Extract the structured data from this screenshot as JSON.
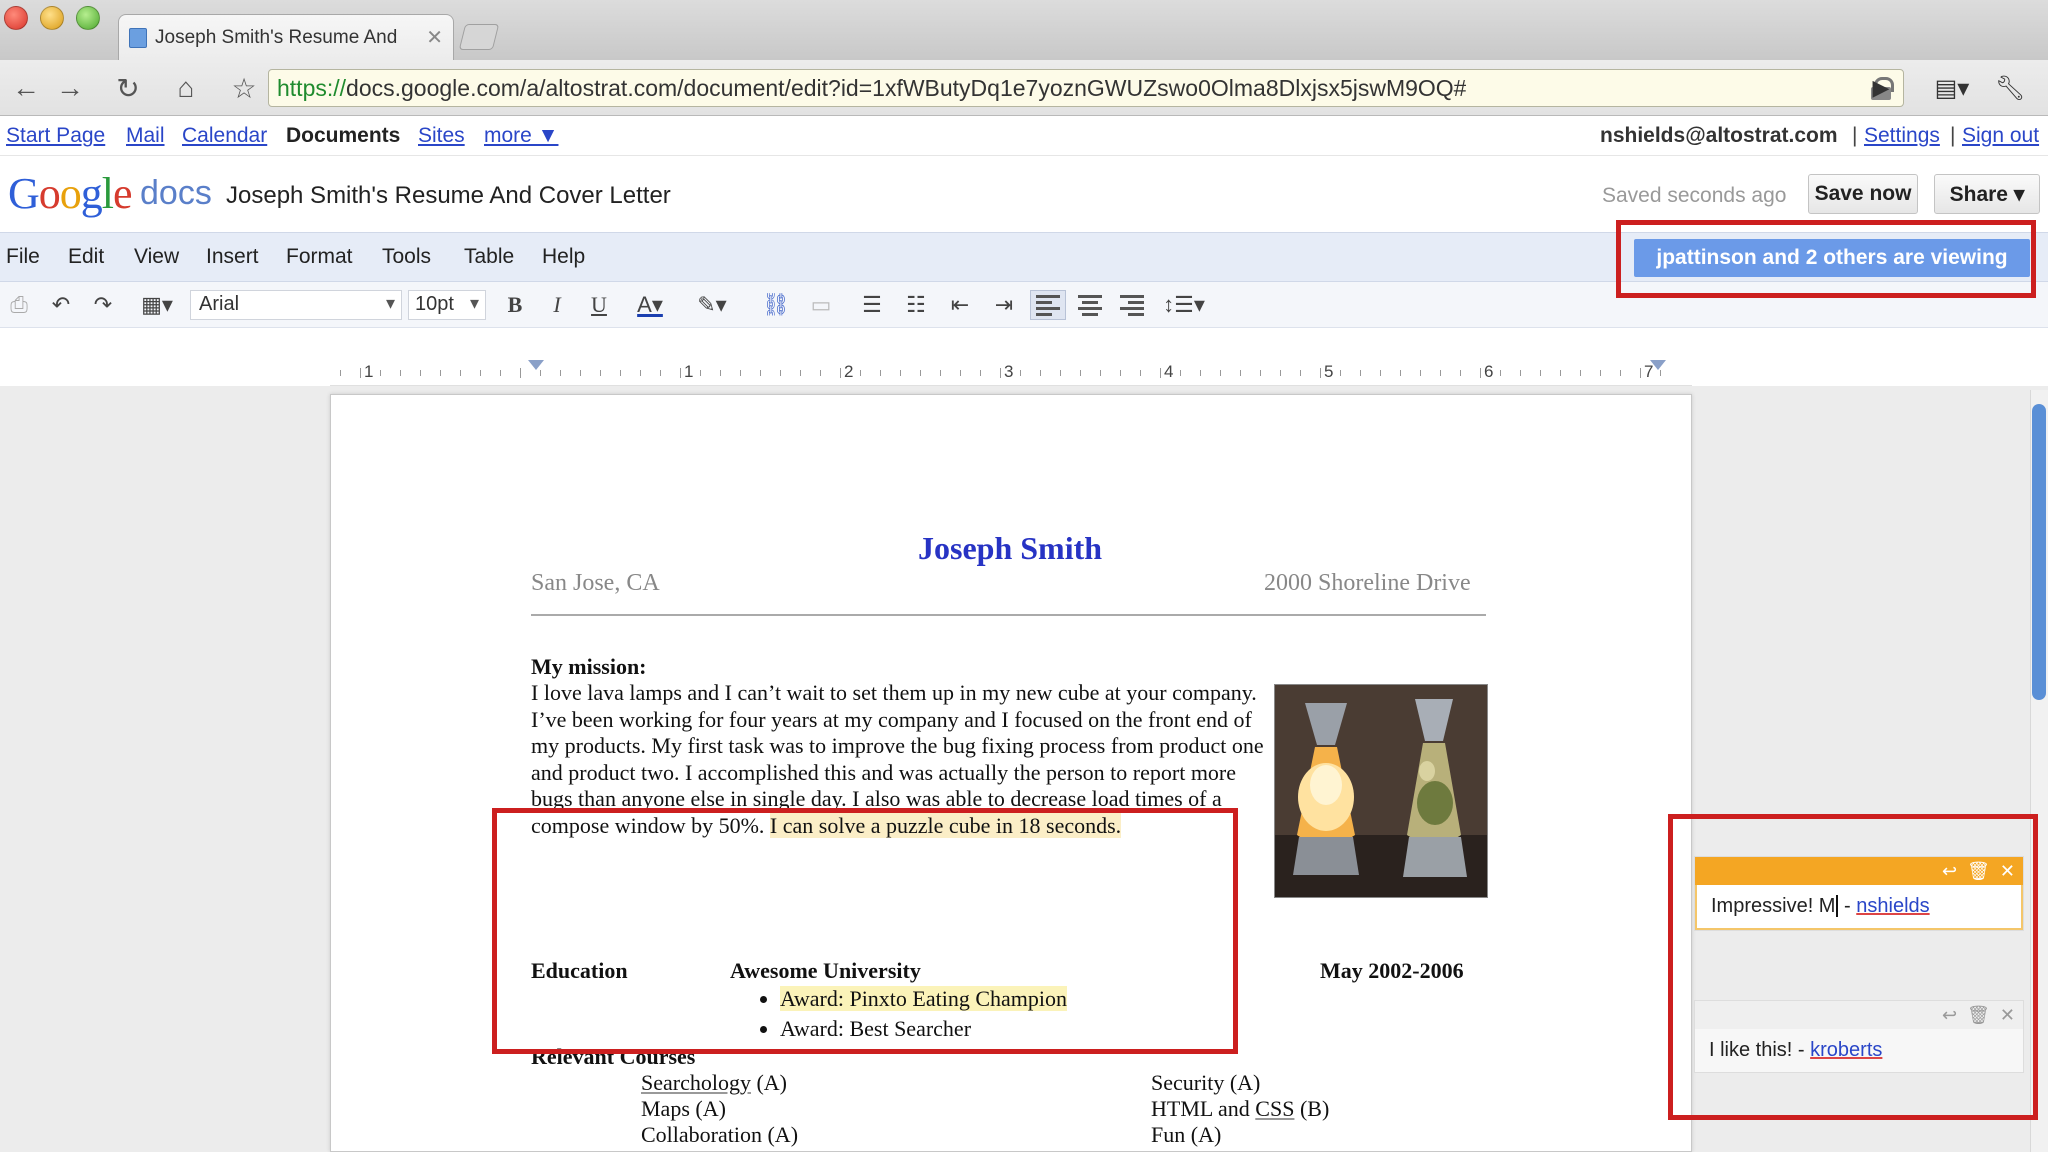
{
  "browser": {
    "tab_title": "Joseph Smith's Resume And",
    "url_scheme": "https://",
    "url_rest": "docs.google.com/a/altostrat.com/document/edit?id=1xfWButyDq1e7yoznGWUZswo0Olma8Dlxjsx5jswM9OQ#"
  },
  "gbar": {
    "links": [
      "Start Page",
      "Mail",
      "Calendar",
      "Documents",
      "Sites",
      "more ▼"
    ],
    "user": "nshields@altostrat.com",
    "settings": "Settings",
    "signout": "Sign out"
  },
  "docs": {
    "docs_word": "docs",
    "title": "Joseph Smith's Resume And Cover Letter",
    "saved_status": "Saved seconds ago",
    "save_now": "Save now",
    "share": "Share ▾",
    "viewing": "jpattinson and 2 others are viewing"
  },
  "menu": [
    "File",
    "Edit",
    "View",
    "Insert",
    "Format",
    "Tools",
    "Table",
    "Help"
  ],
  "toolbar": {
    "font": "Arial",
    "size": "10pt"
  },
  "ruler": [
    "1",
    "1",
    "2",
    "3",
    "4",
    "5",
    "6",
    "7"
  ],
  "doc": {
    "name": "Joseph Smith",
    "location": "San Jose, CA",
    "address": "2000 Shoreline Drive",
    "mission_heading": "My mission:",
    "mission_text": "I love lava lamps and I can’t wait to set them up in my new cube at your company.  I’ve been working for four years at my company and I focused on the front end of my products.  My first task was to improve the bug fixing process from product one and product two.  I accomplished this and was actually the person to report more bugs than anyone else in single day.  I also was able to decrease load times of a compose window by 50%. ",
    "mission_highlight": "I can solve a puzzle cube in 18 seconds.",
    "education_heading": "Education",
    "university": "Awesome University",
    "dates": "May 2002-2006",
    "awards": [
      "Award: Pinxto Eating Champion",
      "Award: Best Searcher"
    ],
    "courses_heading": "Relevant Courses",
    "courses_left": [
      {
        "name": "Searchology",
        "grade": " (A)"
      },
      {
        "name": "Maps",
        "grade": " (A)"
      },
      {
        "name": "Collaboration",
        "grade": " (A)"
      }
    ],
    "courses_right": [
      {
        "name": "Security",
        "grade": " (A)"
      },
      {
        "pre": "HTML and ",
        "name": "CSS",
        "grade": " (B)"
      },
      {
        "name": "Fun",
        "grade": " (A)"
      }
    ]
  },
  "comments": [
    {
      "text": "Impressive! M",
      "author_prefix": " - ",
      "author": "nshields",
      "color": "#f4a623"
    },
    {
      "text": "I like this!",
      "author_prefix": " - ",
      "author": "kroberts",
      "color": "#f3f3f3"
    }
  ],
  "icons": [
    "back-icon",
    "forward-icon",
    "reload-icon",
    "home-icon",
    "star-icon",
    "lock-icon",
    "play-icon",
    "page-icon",
    "wrench-icon"
  ]
}
